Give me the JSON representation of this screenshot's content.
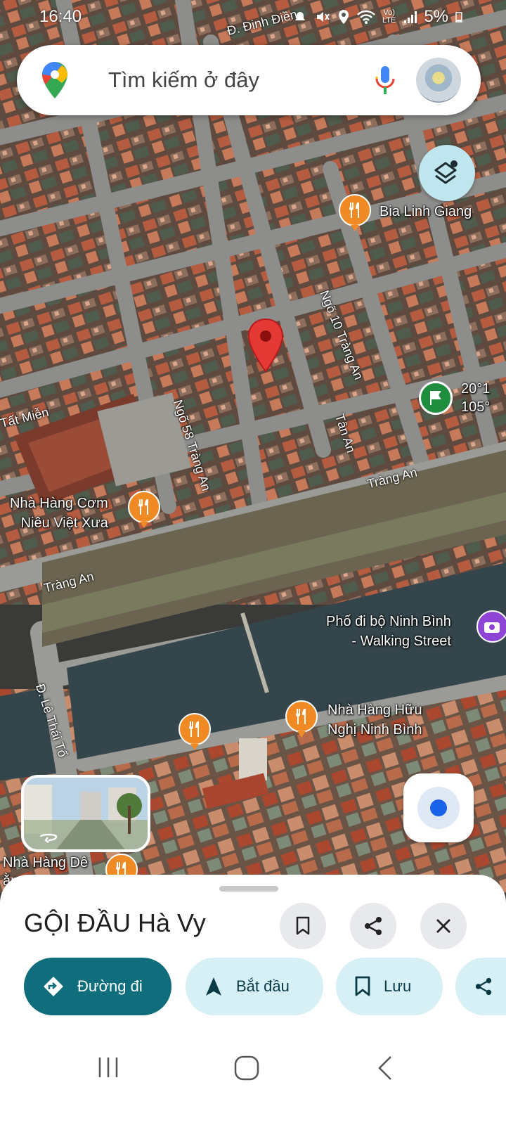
{
  "status_bar": {
    "time": "16:40",
    "battery": "5%",
    "icons": [
      "notification-icon",
      "mute-icon",
      "location-icon",
      "wifi-icon",
      "volte-icon",
      "signal-icon",
      "battery-icon"
    ]
  },
  "search": {
    "placeholder": "Tìm kiếm ở đây"
  },
  "map": {
    "type": "satellite",
    "selected_pin_color": "#e53935",
    "labels": {
      "dinh_dien": "Đ. Đinh Điền",
      "bia_linh_giang": "Bia Linh Giang",
      "ngo_10": "Ngõ 10 Tràng An",
      "coord_1": "20°1",
      "coord_2": "105°",
      "tat_mien": "Tất Miễn",
      "ngo_58": "Ngõ 58 Tràng An",
      "tan_an": "Tân An",
      "trang_an_right": "Tràng An",
      "trang_an_left": "Tràng An",
      "nha_hang_com_1": "Nhà Hàng Cơm",
      "nha_hang_com_2": "Niêu Việt Xưa",
      "pho_di_bo_1": "Phố đi bộ Ninh Bình",
      "pho_di_bo_2": "- Walking Street",
      "le_thai_to": "Đ. Lê Thái Tổ",
      "huu_nghi_1": "Nhà Hàng Hữu",
      "huu_nghi_2": "Nghị Ninh Bình",
      "nha_hang_de_1": "Nhà Hàng Dê",
      "nha_hang_de_2": "ằng"
    }
  },
  "place_sheet": {
    "title": "GỘI ĐẦU Hà Vy",
    "actions": {
      "directions": "Đường đi",
      "start": "Bắt đầu",
      "save": "Lưu"
    }
  },
  "colors": {
    "primary_teal": "#0f6d7c",
    "pill_light": "#d7f0f6",
    "food_poi": "#f08a24",
    "location_dot": "#1a62e8"
  }
}
